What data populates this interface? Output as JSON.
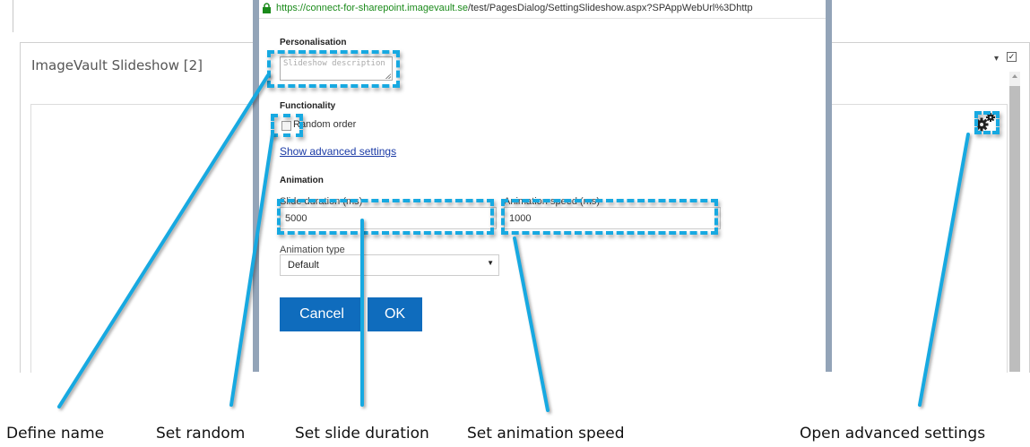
{
  "background": {
    "webpart_title": "ImageVault Slideshow [2]",
    "settings_icon": "gear-icon"
  },
  "dialog": {
    "url": {
      "host": "https://connect-for-sharepoint.imagevault.se",
      "path": "/test/PagesDialog/SettingSlideshow.aspx?SPAppWebUrl%3Dhttp"
    },
    "personalisation": {
      "heading": "Personalisation",
      "description_placeholder": "Slideshow description"
    },
    "functionality": {
      "heading": "Functionality",
      "random_order_label": "Random order",
      "random_order_checked": false,
      "advanced_link": "Show advanced settings"
    },
    "animation": {
      "heading": "Animation",
      "slide_duration_label": "Slide duration (ms)",
      "slide_duration_value": "5000",
      "animation_speed_label": "Animation speed (ms)",
      "animation_speed_value": "1000",
      "animation_type_label": "Animation type",
      "animation_type_value": "Default"
    },
    "buttons": {
      "cancel": "Cancel",
      "ok": "OK"
    }
  },
  "callouts": {
    "define_name": "Define name",
    "set_random": "Set random",
    "set_slide_duration": "Set slide duration",
    "set_animation_speed": "Set animation speed",
    "open_advanced": "Open advanced settings"
  },
  "colors": {
    "accent": "#17a9e1",
    "button": "#0f6cbd",
    "link": "#1a3aa6",
    "dialog_border": "#93a4b8"
  }
}
